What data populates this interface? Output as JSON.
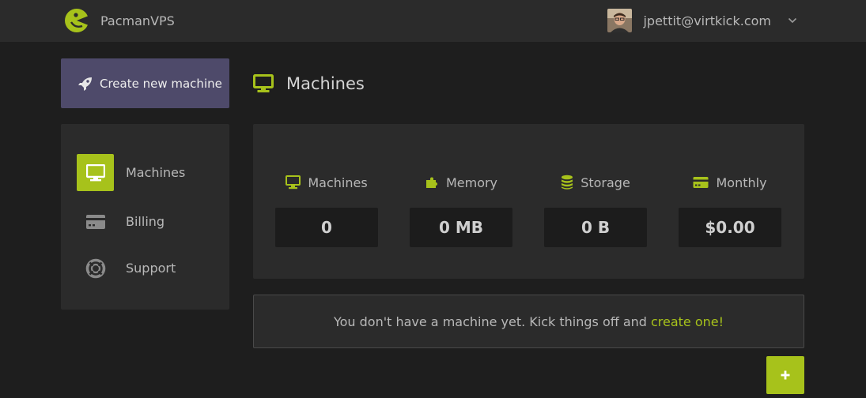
{
  "brand": {
    "name": "PacmanVPS"
  },
  "user": {
    "email": "jpettit@virtkick.com"
  },
  "sidebar": {
    "create_label": "Create new machine",
    "items": [
      {
        "label": "Machines",
        "icon": "monitor-icon",
        "active": true
      },
      {
        "label": "Billing",
        "icon": "credit-card-icon",
        "active": false
      },
      {
        "label": "Support",
        "icon": "life-ring-icon",
        "active": false
      }
    ]
  },
  "main": {
    "title": "Machines",
    "stats": [
      {
        "label": "Machines",
        "value": "0",
        "icon": "monitor-icon"
      },
      {
        "label": "Memory",
        "value": "0 MB",
        "icon": "puzzle-icon"
      },
      {
        "label": "Storage",
        "value": "0 B",
        "icon": "database-icon"
      },
      {
        "label": "Monthly",
        "value": "$0.00",
        "icon": "credit-card-icon"
      }
    ],
    "empty_message": "You don't have a machine yet. Kick things off and",
    "empty_link": "create one!",
    "add_button": "+"
  },
  "colors": {
    "accent": "#a7c21b",
    "create_button": "#4e4a6a",
    "panel": "#2b2b2b",
    "background": "#1e1e1e"
  }
}
